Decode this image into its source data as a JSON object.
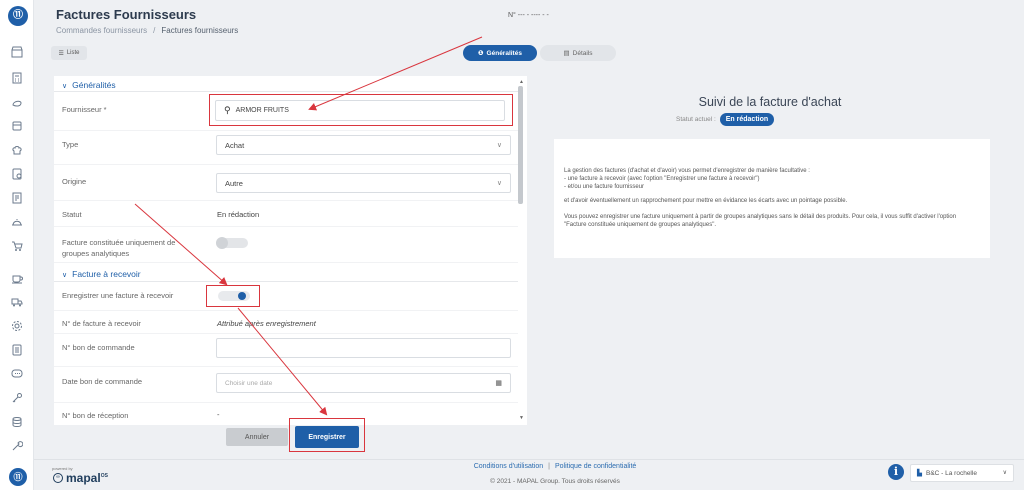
{
  "header": {
    "title": "Factures Fournisseurs",
    "breadcrumb": [
      "Commandes fournisseurs",
      "/",
      "Factures fournisseurs"
    ],
    "doc_number": "N° --- - ---- - -"
  },
  "toolbar": {
    "liste_label": "Liste",
    "tabs": [
      {
        "label": "Généralités",
        "active": true
      },
      {
        "label": "Détails",
        "active": false
      }
    ]
  },
  "form": {
    "section_generalites": "Généralités",
    "fournisseur_label": "Fournisseur *",
    "fournisseur_value": "ARMOR FRUITS",
    "type_label": "Type",
    "type_value": "Achat",
    "origine_label": "Origine",
    "origine_value": "Autre",
    "statut_label": "Statut",
    "statut_value": "En rédaction",
    "analytique_label_1": "Facture constituée uniquement de",
    "analytique_label_2": "groupes analytiques",
    "analytique_on": false,
    "section_recevoir": "Facture à recevoir",
    "enregistrer_recevoir_label": "Enregistrer une facture à recevoir",
    "enregistrer_recevoir_on": true,
    "num_facture_label": "N° de facture à recevoir",
    "num_facture_value": "Attribué après enregistrement",
    "bon_commande_label": "N° bon de commande",
    "bon_commande_value": "",
    "date_bon_label": "Date bon de commande",
    "date_bon_placeholder": "Choisir une date",
    "bon_reception_label": "N° bon de réception",
    "bon_reception_value": "-"
  },
  "actions": {
    "cancel_label": "Annuler",
    "save_label": "Enregistrer"
  },
  "info": {
    "title": "Suivi de la facture d'achat",
    "status_label": "Statut actuel :",
    "status_value": "En rédaction",
    "p1": "La gestion des factures (d'achat et d'avoir) vous permet d'enregistrer de manière facultative :",
    "p1_item1": "- une facture à recevoir (avec l'option \"Enregistrer une facture à recevoir\")",
    "p1_item2": "- et/ou une facture fournisseur",
    "p2": "et d'avoir éventuellement un rapprochement pour mettre en évidance les écarts avec un pointage possible.",
    "p3": "Vous pouvez enregistrer une facture uniquement à partir de groupes analytiques sans le détail des produits. Pour cela, il vous suffit d'activer l'option \"Facture constituée uniquement de groupes analytiques\"."
  },
  "footer": {
    "powered_by": "powered by",
    "brand": "mapal",
    "brand_suffix": "OS",
    "link_terms": "Conditions d'utilisation",
    "link_sep": "|",
    "link_privacy": "Politique de confidentialité",
    "copyright": "© 2021 - MAPAL Group. Tous droits réservés",
    "site_label": "B&C - La rochelle"
  },
  "colors": {
    "primary": "#1f5fa8",
    "annotation": "#d9363e"
  }
}
